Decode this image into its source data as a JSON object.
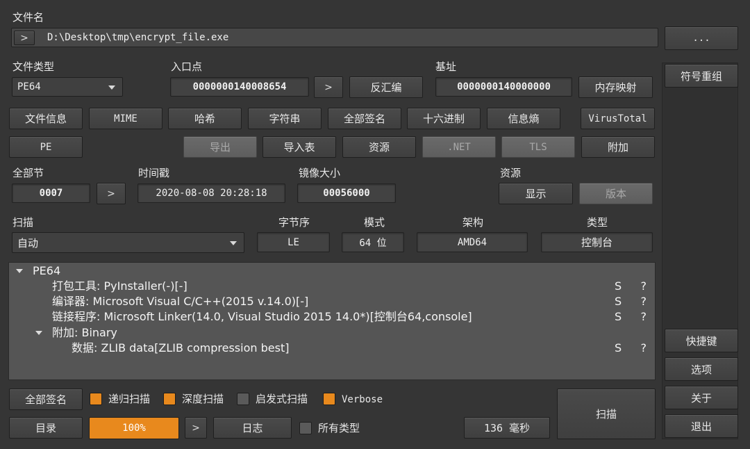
{
  "filename": {
    "label": "文件名",
    "path": "D:\\Desktop\\tmp\\encrypt_file.exe",
    "browse": "...",
    "go": ">"
  },
  "filetype": {
    "label": "文件类型",
    "value": "PE64"
  },
  "entry": {
    "label": "入口点",
    "value": "0000000140008654",
    "go": ">",
    "disasm": "反汇编"
  },
  "base": {
    "label": "基址",
    "value": "0000000140000000",
    "memmap": "内存映射"
  },
  "buttons_row1": [
    "文件信息",
    "MIME",
    "哈希",
    "字符串",
    "全部签名",
    "十六进制",
    "信息熵",
    "VirusTotal"
  ],
  "buttons_row2": {
    "pe": "PE",
    "export": "导出",
    "import": "导入表",
    "resource": "资源",
    "net": ".NET",
    "tls": "TLS",
    "overlay": "附加"
  },
  "sections": {
    "label": "全部节",
    "value": "0007",
    "go": ">"
  },
  "timestamp": {
    "label": "时间戳",
    "value": "2020-08-08 20:28:18"
  },
  "imagesize": {
    "label": "镜像大小",
    "value": "00056000"
  },
  "resources": {
    "label": "资源",
    "show": "显示",
    "version": "版本"
  },
  "scan": {
    "label": "扫描",
    "mode_value": "自动"
  },
  "endian": {
    "label": "字节序",
    "value": "LE"
  },
  "mode": {
    "label": "模式",
    "value": "64 位"
  },
  "arch": {
    "label": "架构",
    "value": "AMD64"
  },
  "type": {
    "label": "类型",
    "value": "控制台"
  },
  "tree": [
    {
      "text": "PE64"
    },
    {
      "text": "打包工具: PyInstaller(-)[-]",
      "s": "S",
      "q": "?"
    },
    {
      "text": "编译器: Microsoft Visual C/C++(2015 v.14.0)[-]",
      "s": "S",
      "q": "?"
    },
    {
      "text": "链接程序: Microsoft Linker(14.0, Visual Studio 2015 14.0*)[控制台64,console]",
      "s": "S",
      "q": "?"
    },
    {
      "text": "附加: Binary"
    },
    {
      "text": "数据: ZLIB data[ZLIB compression best]",
      "s": "S",
      "q": "?"
    }
  ],
  "bottom": {
    "all_signatures": "全部签名",
    "recursive": "递归扫描",
    "deep": "深度扫描",
    "heuristic": "启发式扫描",
    "verbose": "Verbose",
    "directory": "目录",
    "progress": "100%",
    "progress_value": 100,
    "go": ">",
    "log": "日志",
    "all_types": "所有类型",
    "elapsed": "136 毫秒",
    "scan_button": "扫描"
  },
  "side": {
    "symbol": "符号重组",
    "shortcuts": "快捷键",
    "options": "选项",
    "about": "关于",
    "exit": "退出"
  },
  "colors": {
    "accent": "#e8891d",
    "background": "#353535",
    "tree_bg": "#555555"
  }
}
